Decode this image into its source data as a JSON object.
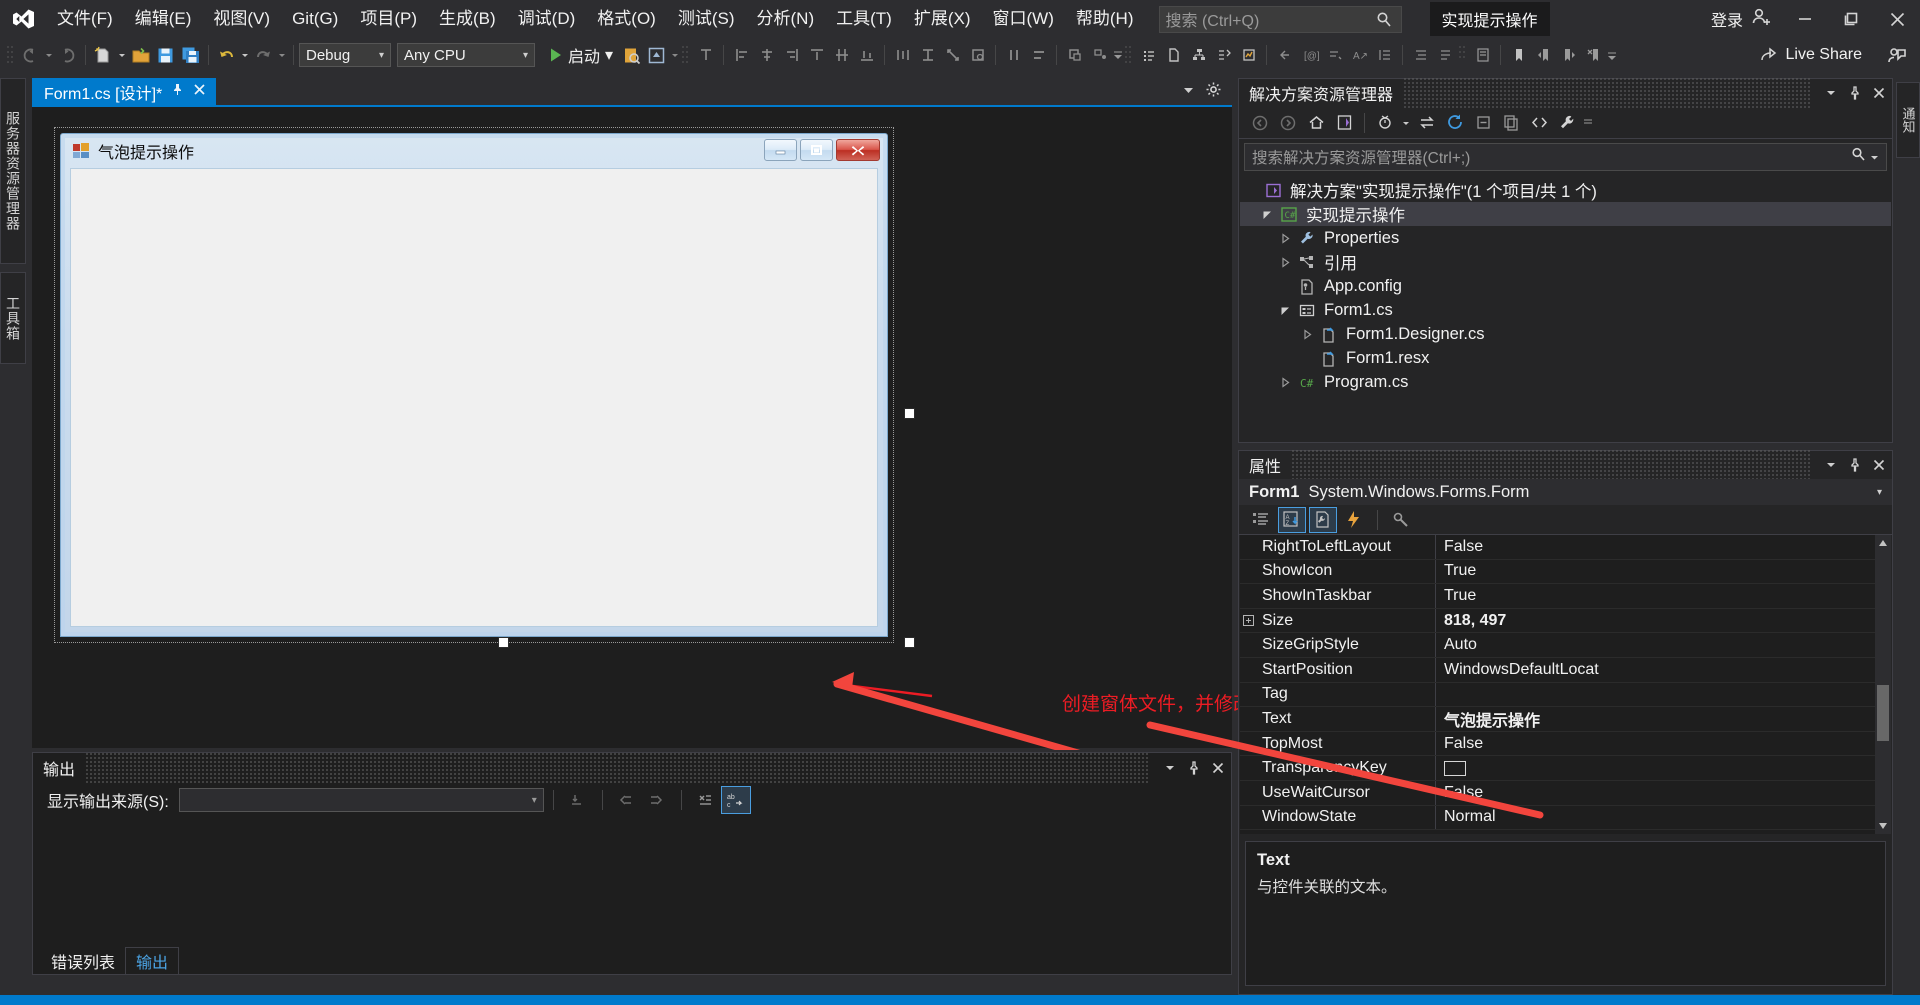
{
  "app": {
    "menus": [
      "文件(F)",
      "编辑(E)",
      "视图(V)",
      "Git(G)",
      "项目(P)",
      "生成(B)",
      "调试(D)",
      "格式(O)",
      "测试(S)",
      "分析(N)",
      "工具(T)",
      "扩展(X)",
      "窗口(W)",
      "帮助(H)"
    ],
    "search_placeholder": "搜索 (Ctrl+Q)",
    "solution_name": "实现提示操作",
    "sign_in": "登录",
    "window_buttons": {
      "minimize": "minimize-icon",
      "maximize": "maximize-icon",
      "close": "close-icon"
    }
  },
  "toolbar": {
    "configuration": "Debug",
    "platform": "Any CPU",
    "start_label": "启动",
    "live_share": "Live Share"
  },
  "left_tabs": [
    {
      "label": "服务器资源管理器"
    },
    {
      "label": "工具箱"
    }
  ],
  "right_tab": {
    "label": "通知"
  },
  "document": {
    "tab_label": "Form1.cs [设计]*",
    "pin": "pin-icon",
    "close": "close-icon"
  },
  "winform": {
    "title": "气泡提示操作",
    "minimize": "minimize-icon",
    "maximize": "maximize-icon",
    "close": "close-icon"
  },
  "annotation": {
    "text": "创建窗体文件，并修改名字",
    "color": "#ed1c24"
  },
  "output": {
    "title": "输出",
    "source_label": "显示输出来源(S):",
    "source_value": "",
    "tabs": [
      {
        "label": "错误列表",
        "active": false
      },
      {
        "label": "输出",
        "active": true
      }
    ]
  },
  "solution_explorer": {
    "title": "解决方案资源管理器",
    "search_placeholder": "搜索解决方案资源管理器(Ctrl+;)",
    "tree": [
      {
        "label": "解决方案\"实现提示操作\"(1 个项目/共 1 个)",
        "indent": 0,
        "icon": "solution-icon",
        "expander": "none",
        "selected": false
      },
      {
        "label": "实现提示操作",
        "indent": 1,
        "icon": "csharp-project-icon",
        "expander": "open",
        "selected": true
      },
      {
        "label": "Properties",
        "indent": 2,
        "icon": "wrench-icon",
        "expander": "closed",
        "selected": false
      },
      {
        "label": "引用",
        "indent": 2,
        "icon": "references-icon",
        "expander": "closed",
        "selected": false
      },
      {
        "label": "App.config",
        "indent": 2,
        "icon": "config-file-icon",
        "expander": "none",
        "selected": false
      },
      {
        "label": "Form1.cs",
        "indent": 2,
        "icon": "form-icon",
        "expander": "open",
        "selected": false
      },
      {
        "label": "Form1.Designer.cs",
        "indent": 3,
        "icon": "code-file-icon",
        "expander": "closed",
        "selected": false
      },
      {
        "label": "Form1.resx",
        "indent": 3,
        "icon": "code-file-icon",
        "expander": "none",
        "selected": false
      },
      {
        "label": "Program.cs",
        "indent": 2,
        "icon": "csharp-file-icon",
        "expander": "closed",
        "selected": false
      }
    ]
  },
  "properties": {
    "title": "属性",
    "object_name": "Form1",
    "object_type": "System.Windows.Forms.Form",
    "rows": [
      {
        "name": "RightToLeftLayout",
        "value": "False",
        "bold": false,
        "expandable": false,
        "swatch": false
      },
      {
        "name": "ShowIcon",
        "value": "True",
        "bold": false,
        "expandable": false,
        "swatch": false
      },
      {
        "name": "ShowInTaskbar",
        "value": "True",
        "bold": false,
        "expandable": false,
        "swatch": false
      },
      {
        "name": "Size",
        "value": "818, 497",
        "bold": true,
        "expandable": true,
        "swatch": false
      },
      {
        "name": "SizeGripStyle",
        "value": "Auto",
        "bold": false,
        "expandable": false,
        "swatch": false
      },
      {
        "name": "StartPosition",
        "value": "WindowsDefaultLocat",
        "bold": false,
        "expandable": false,
        "swatch": false
      },
      {
        "name": "Tag",
        "value": "",
        "bold": false,
        "expandable": false,
        "swatch": false
      },
      {
        "name": "Text",
        "value": "气泡提示操作",
        "bold": true,
        "expandable": false,
        "swatch": false
      },
      {
        "name": "TopMost",
        "value": "False",
        "bold": false,
        "expandable": false,
        "swatch": false
      },
      {
        "name": "TransparencyKey",
        "value": "",
        "bold": false,
        "expandable": false,
        "swatch": true
      },
      {
        "name": "UseWaitCursor",
        "value": "False",
        "bold": false,
        "expandable": false,
        "swatch": false
      },
      {
        "name": "WindowState",
        "value": "Normal",
        "bold": false,
        "expandable": false,
        "swatch": false
      }
    ],
    "description": {
      "header": "Text",
      "detail": "与控件关联的文本。"
    }
  }
}
